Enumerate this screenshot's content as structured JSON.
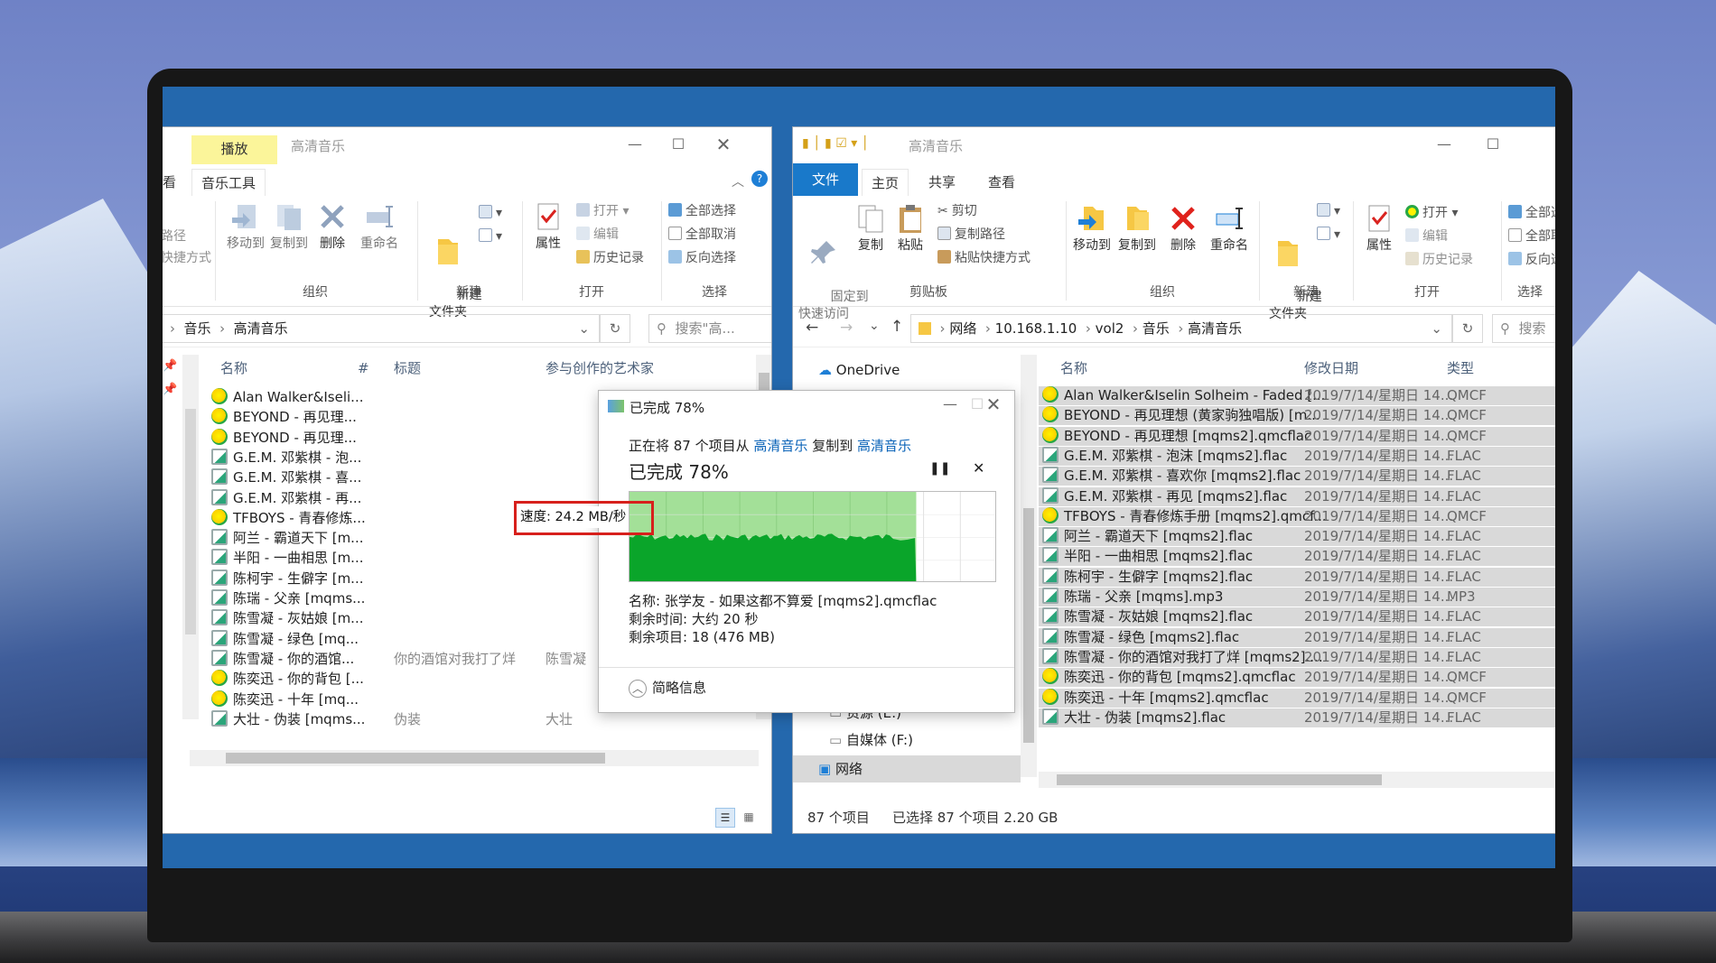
{
  "left_window": {
    "title": "高清音乐",
    "context_tab": "播放",
    "tabs": [
      "看",
      "音乐工具"
    ],
    "ribbon": {
      "partial_left": [
        "路径",
        "快捷方式"
      ],
      "organize": {
        "move_to": "移动到",
        "copy_to": "复制到",
        "delete": "删除",
        "rename": "重命名",
        "label": "组织"
      },
      "new": {
        "new_folder": "新建\n文件夹",
        "label": "新建"
      },
      "open": {
        "properties": "属性",
        "open": "打开",
        "edit": "编辑",
        "history": "历史记录",
        "label": "打开"
      },
      "select": {
        "select_all": "全部选择",
        "select_none": "全部取消",
        "invert": "反向选择",
        "label": "选择"
      }
    },
    "breadcrumb": [
      "音乐",
      "高清音乐"
    ],
    "search_placeholder": "搜索\"高...",
    "columns": {
      "name": "名称",
      "num": "#",
      "title": "标题",
      "artist": "参与创作的艺术家"
    },
    "files": [
      {
        "name": "Alan Walker&Iseli...",
        "type": "q"
      },
      {
        "name": "BEYOND - 再见理...",
        "type": "q"
      },
      {
        "name": "BEYOND - 再见理...",
        "type": "q"
      },
      {
        "name": "G.E.M. 邓紫棋 - 泡...",
        "type": "f"
      },
      {
        "name": "G.E.M. 邓紫棋 - 喜...",
        "type": "f"
      },
      {
        "name": "G.E.M. 邓紫棋 - 再...",
        "type": "f"
      },
      {
        "name": "TFBOYS - 青春修炼...",
        "type": "q"
      },
      {
        "name": "阿兰 - 霸道天下 [m...",
        "type": "f"
      },
      {
        "name": "半阳 - 一曲相思 [m...",
        "type": "f"
      },
      {
        "name": "陈柯宇 - 生僻字 [m...",
        "type": "f"
      },
      {
        "name": "陈瑞 - 父亲 [mqms...",
        "type": "m"
      },
      {
        "name": "陈雪凝 - 灰姑娘 [m...",
        "type": "f"
      },
      {
        "name": "陈雪凝 - 绿色 [mq...",
        "type": "f"
      },
      {
        "name": "陈雪凝 - 你的酒馆...",
        "type": "f",
        "title": "你的酒馆对我打了烊",
        "artist": "陈雪凝"
      },
      {
        "name": "陈奕迅 - 你的背包 [...",
        "type": "q"
      },
      {
        "name": "陈奕迅 - 十年 [mq...",
        "type": "q"
      },
      {
        "name": "大壮 - 伪装 [mqms...",
        "type": "f",
        "title": "伪装",
        "artist": "大壮"
      }
    ]
  },
  "right_window": {
    "title": "高清音乐",
    "tabs": {
      "file": "文件",
      "home": "主页",
      "share": "共享",
      "view": "查看"
    },
    "ribbon": {
      "clipboard": {
        "pin": "固定到\n快速访问",
        "copy": "复制",
        "paste": "粘贴",
        "cut": "剪切",
        "copy_path": "复制路径",
        "paste_shortcut": "粘贴快捷方式",
        "label": "剪贴板"
      },
      "organize": {
        "move_to": "移动到",
        "copy_to": "复制到",
        "delete": "删除",
        "rename": "重命名",
        "label": "组织"
      },
      "new": {
        "new_folder": "新建\n文件夹",
        "label": "新建"
      },
      "open": {
        "properties": "属性",
        "open": "打开",
        "edit": "编辑",
        "history": "历史记录",
        "label": "打开"
      },
      "select": {
        "select_all": "全部选",
        "select_none": "全部取",
        "invert": "反向选",
        "label": "选择"
      }
    },
    "breadcrumb": [
      "网络",
      "10.168.1.10",
      "vol2",
      "音乐",
      "高清音乐"
    ],
    "search_placeholder": "搜索",
    "nav": {
      "onedrive": "OneDrive",
      "drive_e": "资源 (E:)",
      "drive_f": "自媒体 (F:)",
      "network": "网络"
    },
    "columns": {
      "name": "名称",
      "date": "修改日期",
      "type": "类型"
    },
    "files": [
      {
        "name": "Alan Walker&Iselin Solheim - Faded [...",
        "date": "2019/7/14/星期日 14...",
        "type": "QMCF",
        "icon": "q"
      },
      {
        "name": "BEYOND - 再见理想 (黄家驹独唱版) [m...",
        "date": "2019/7/14/星期日 14...",
        "type": "QMCF",
        "icon": "q"
      },
      {
        "name": "BEYOND - 再见理想 [mqms2].qmcflac",
        "date": "2019/7/14/星期日 14...",
        "type": "QMCF",
        "icon": "q"
      },
      {
        "name": "G.E.M. 邓紫棋 - 泡沫 [mqms2].flac",
        "date": "2019/7/14/星期日 14...",
        "type": "FLAC",
        "icon": "f"
      },
      {
        "name": "G.E.M. 邓紫棋 - 喜欢你 [mqms2].flac",
        "date": "2019/7/14/星期日 14...",
        "type": "FLAC",
        "icon": "f"
      },
      {
        "name": "G.E.M. 邓紫棋 - 再见 [mqms2].flac",
        "date": "2019/7/14/星期日 14...",
        "type": "FLAC",
        "icon": "f"
      },
      {
        "name": "TFBOYS - 青春修炼手册 [mqms2].qmcf...",
        "date": "2019/7/14/星期日 14...",
        "type": "QMCF",
        "icon": "q"
      },
      {
        "name": "阿兰 - 霸道天下 [mqms2].flac",
        "date": "2019/7/14/星期日 14...",
        "type": "FLAC",
        "icon": "f"
      },
      {
        "name": "半阳 - 一曲相思 [mqms2].flac",
        "date": "2019/7/14/星期日 14...",
        "type": "FLAC",
        "icon": "f"
      },
      {
        "name": "陈柯宇 - 生僻字 [mqms2].flac",
        "date": "2019/7/14/星期日 14...",
        "type": "FLAC",
        "icon": "f"
      },
      {
        "name": "陈瑞 - 父亲 [mqms].mp3",
        "date": "2019/7/14/星期日 14...",
        "type": "MP3",
        "icon": "m"
      },
      {
        "name": "陈雪凝 - 灰姑娘 [mqms2].flac",
        "date": "2019/7/14/星期日 14...",
        "type": "FLAC",
        "icon": "f"
      },
      {
        "name": "陈雪凝 - 绿色 [mqms2].flac",
        "date": "2019/7/14/星期日 14...",
        "type": "FLAC",
        "icon": "f"
      },
      {
        "name": "陈雪凝 - 你的酒馆对我打了烊 [mqms2]....",
        "date": "2019/7/14/星期日 14...",
        "type": "FLAC",
        "icon": "f"
      },
      {
        "name": "陈奕迅 - 你的背包 [mqms2].qmcflac",
        "date": "2019/7/14/星期日 14...",
        "type": "QMCF",
        "icon": "q"
      },
      {
        "name": "陈奕迅 - 十年 [mqms2].qmcflac",
        "date": "2019/7/14/星期日 14...",
        "type": "QMCF",
        "icon": "q"
      },
      {
        "name": "大壮 - 伪装 [mqms2].flac",
        "date": "2019/7/14/星期日 14...",
        "type": "FLAC",
        "icon": "f"
      }
    ],
    "status": {
      "count": "87 个项目",
      "selected": "已选择 87 个项目  2.20 GB"
    }
  },
  "dialog": {
    "title": "已完成 78%",
    "line_prefix": "正在将 87 个项目从 ",
    "source": "高清音乐",
    "line_mid": " 复制到 ",
    "dest": "高清音乐",
    "progress_label": "已完成 78%",
    "progress": 0.78,
    "speed": "速度: 24.2 MB/秒",
    "name": "名称: 张学友 - 如果这都不算爱 [mqms2].qmcflac",
    "time_left": "剩余时间: 大约 20 秒",
    "items_left": "剩余项目: 18 (476 MB)",
    "less_details": "简略信息"
  }
}
